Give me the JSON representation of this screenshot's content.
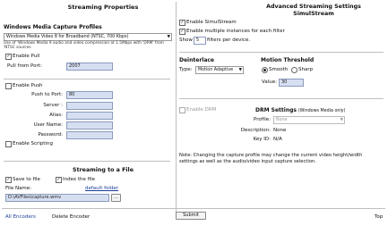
{
  "streaming": {
    "heading": "Streaming Properties",
    "profiles_title": "Windows Media Capture Profiles",
    "profile_value": "Windows Media Video 8 for Broadband (NTSC, 700 Kbps)",
    "profile_desc": "Use of 'Windows Media 9 audio and video compression at 1.5Mbps with 'DRM' from 'NTSC sources",
    "enable_pull_label": "Enable Pull",
    "pull_port_label": "Pull from Port:",
    "pull_port_value": "2007",
    "enable_push_label": "Enable Push",
    "push_port_label": "Push to Port:",
    "push_port_value": "80",
    "server_label": "Server :",
    "alias_label": "Alias:",
    "username_label": "User Name:",
    "password_label": "Password:",
    "enable_scripting_label": "Enable Scripting"
  },
  "file": {
    "heading": "Streaming to a File",
    "save_label": "Save to file",
    "index_label": "Index the file",
    "name_label": "File Name:",
    "default_folder": "default folder",
    "name_value": "D:\\AVFiles\\capture.wmv",
    "browse_label": "..."
  },
  "advanced": {
    "heading_line1": "Advanced Streaming Settings",
    "heading_line2": "SimulStream",
    "enable_simulstream": "Enable SimulStream",
    "enable_multiple": "Enable multiple instances for each filter",
    "show_label": "Show",
    "show_value": "5",
    "filters_label": "filters per device."
  },
  "deinterlace": {
    "heading": "Deinterlace",
    "type_label": "Type:",
    "type_value": "Motion Adaptive"
  },
  "motion": {
    "heading": "Motion Threshold",
    "smooth_label": "Smooth",
    "sharp_label": "Sharp",
    "value_label": "Value:",
    "value": "30"
  },
  "drm": {
    "enable_label": "Enable DRM",
    "heading": "DRM Settings",
    "heading_sub": "(Windows Media only)",
    "profile_label": "Profile:",
    "profile_value": "None",
    "description_label": "Description:",
    "description_value": "None",
    "keyid_label": "Key ID:",
    "keyid_value": "N/A"
  },
  "note": "Note: Changing the capture profile may change the current video height/width settings as well as the audio/video input capture selection.",
  "footer": {
    "all_encoders": "All Encoders",
    "delete_encoder": "Delete Encoder",
    "submit": "Submit",
    "top": "Top"
  }
}
